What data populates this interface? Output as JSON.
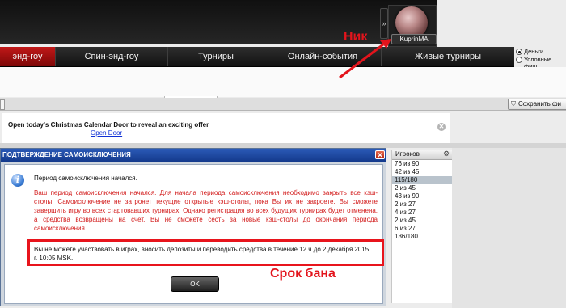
{
  "header": {
    "username": "KuprinMA"
  },
  "nav": {
    "tabs": [
      {
        "label": "энд-гоу",
        "active": true
      },
      {
        "label": "Спин-энд-гоу",
        "active": false
      },
      {
        "label": "Турниры",
        "active": false
      },
      {
        "label": "Онлайн-события",
        "active": false
      },
      {
        "label": "Живые турниры",
        "active": false
      }
    ],
    "currency": {
      "options": [
        "Деньги",
        "Условные фиш"
      ],
      "selected": "Деньги"
    }
  },
  "toolbar": {
    "save_filter_label": "Сохранить фи"
  },
  "promo": {
    "text": "Open today's Christmas Calendar Door to reveal an exciting offer",
    "link": "Open Door"
  },
  "players": {
    "header": "Игроков",
    "rows": [
      "76 из 90",
      "42 из 45",
      "115/180",
      "2 из 45",
      "43 из 90",
      "2 из 27",
      "4 из 27",
      "2 из 45",
      "6 из 27",
      "136/180"
    ],
    "selected_index": 2
  },
  "dialog": {
    "title": "ПОДТВЕРЖДЕНИЕ САМОИСКЛЮЧЕНИЯ",
    "heading": "Период самоисключения начался.",
    "body": "Ваш период самоисключения начался. Для начала периода самоисключения необходимо закрыть все кэш-столы. Самоисключение не затронет текущие открытые кэш-столы, пока Вы их не закроете. Вы сможете завершить игру во всех стартовавших турнирах. Однако регистрация во всех будущих турнирах будет отменена, а средства возвращены на счет. Вы не сможете сесть за новые кэш-столы до окончания периода самоисключения.",
    "ban_notice": "Вы не можете участвовать в играх, вносить депозиты и переводить средства в течение 12 ч до 2 декабря 2015 г. 10:05 MSK.",
    "ok_label": "OK"
  },
  "annotations": {
    "nick": "Ник",
    "ban": "Срок бана",
    "color": "#e3141c"
  },
  "colors": {
    "active_tab": "#c01818",
    "dialog_title": "#2b5ab7",
    "link": "#0e2fd5",
    "selected_row": "#b9c3cc"
  }
}
